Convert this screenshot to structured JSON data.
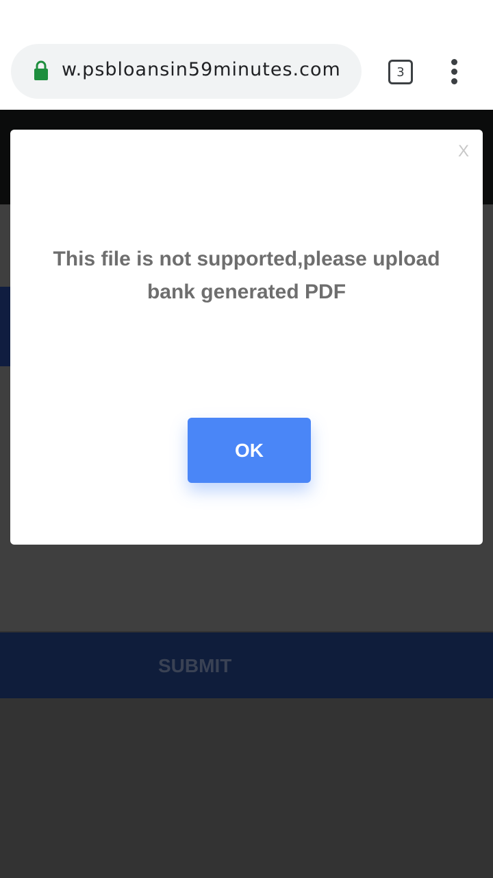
{
  "browser": {
    "url": "w.psbloansin59minutes.com",
    "tab_count": "3",
    "icons": {
      "lock": "lock-icon",
      "menu": "more-vert-icon"
    },
    "lock_color": "#1e8e3e"
  },
  "page": {
    "submit_label": "SUBMIT"
  },
  "dialog": {
    "close_label": "X",
    "message": "This file is not supported,please upload bank generated PDF",
    "ok_label": "OK",
    "ok_color": "#4a86f7"
  }
}
